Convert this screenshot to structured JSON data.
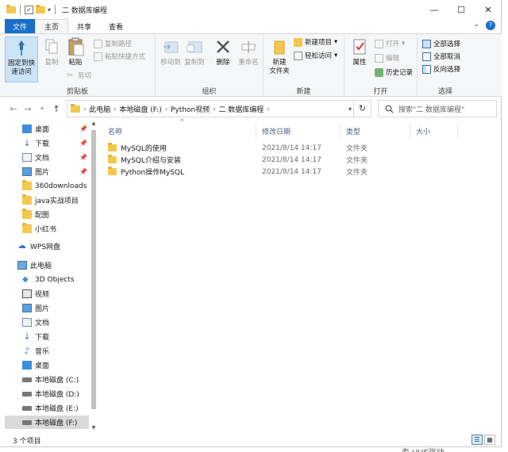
{
  "title_bar": {
    "path_title": "二 数据库编程",
    "minimize_glyph": "—",
    "maximize_glyph": "☐",
    "close_glyph": "✕"
  },
  "ribbon_tabs": [
    "文件",
    "主页",
    "共享",
    "查看"
  ],
  "ribbon": {
    "clipboard": {
      "label": "剪贴板",
      "pin": "固定到快\n速访问",
      "copy": "复制",
      "paste": "粘贴",
      "copy_path": "复制路径",
      "paste_shortcut": "粘贴快捷方式",
      "cut": "剪切"
    },
    "organize": {
      "label": "组织",
      "move_to": "移动到",
      "copy_to": "复制到",
      "delete": "删除",
      "rename": "重命名"
    },
    "new": {
      "label": "新建",
      "new_folder": "新建\n文件夹",
      "new_item": "新建项目",
      "easy_access": "轻松访问"
    },
    "open": {
      "label": "打开",
      "properties": "属性",
      "open": "打开",
      "edit": "编辑",
      "history": "历史记录"
    },
    "select": {
      "label": "选择",
      "select_all": "全部选择",
      "select_none": "全部取消",
      "invert": "反向选择"
    }
  },
  "address_bar": {
    "crumbs": [
      "此电脑",
      "本地磁盘 (F:)",
      "Python视频",
      "二 数据库编程"
    ],
    "search_placeholder": "搜索\"二 数据库编程\""
  },
  "nav_pane": {
    "quick_access": [
      "桌面",
      "下载",
      "文档",
      "图片",
      "360downloads",
      "java实战项目",
      "配图",
      "小红书"
    ],
    "wps": "WPS网盘",
    "this_pc": "此电脑",
    "pc_items": [
      "3D Objects",
      "视频",
      "图片",
      "文档",
      "下载",
      "音乐",
      "桌面",
      "本地磁盘 (C:)",
      "本地磁盘 (D:)",
      "本地磁盘 (E:)",
      "本地磁盘 (F:)"
    ]
  },
  "file_list": {
    "columns": [
      "名称",
      "修改日期",
      "类型",
      "大小"
    ],
    "rows": [
      {
        "name": "MySQL的使用",
        "date": "2021/8/14 14:17",
        "type": "文件夹"
      },
      {
        "name": "MySQL介绍与安装",
        "date": "2021/8/14 14:17",
        "type": "文件夹"
      },
      {
        "name": "Python操作MySQL",
        "date": "2021/8/14 14:17",
        "type": "文件夹"
      }
    ]
  },
  "status_bar": {
    "item_count": "3 个项目"
  },
  "background_text": "专 VUE驱动",
  "colors": {
    "file_tab": "#1a6fc9",
    "folder": "#f4c74e",
    "selected": "#d9d9d9"
  }
}
